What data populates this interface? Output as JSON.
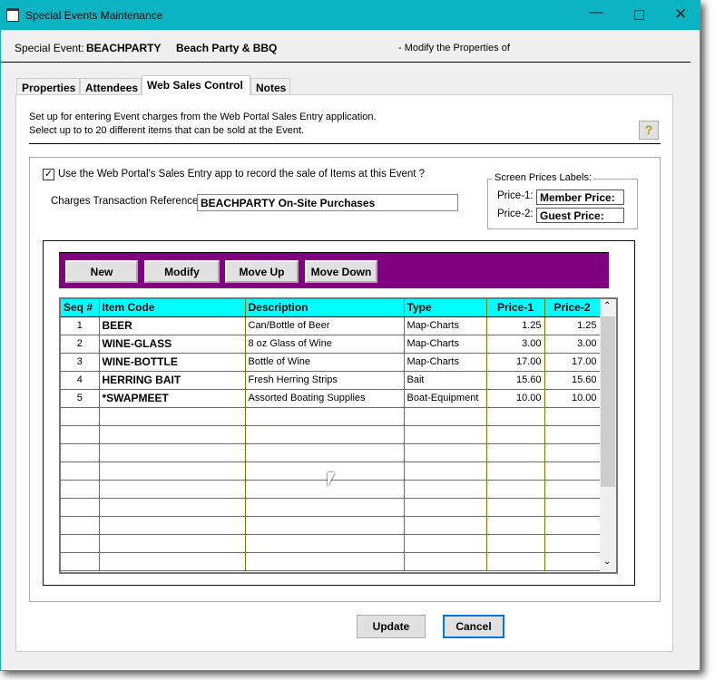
{
  "window": {
    "title": "Special Events Maintenance"
  },
  "header": {
    "label": "Special Event:",
    "code": "BEACHPARTY",
    "name": "Beach Party & BBQ",
    "mode": "- Modify the Properties of"
  },
  "tabs": [
    {
      "label": "Properties"
    },
    {
      "label": "Attendees"
    },
    {
      "label": "Web Sales Control",
      "active": true
    },
    {
      "label": "Notes"
    }
  ],
  "intro": [
    "Set up for entering Event charges from the Web Portal Sales Entry application.",
    "Select up to to 20 different items that can be sold at the Event."
  ],
  "use_web_portal": {
    "label": "Use the Web Portal's Sales Entry app to record the sale of Items at this Event ?",
    "checked": true
  },
  "charges_ref": {
    "label": "Charges Transaction Reference:",
    "value": "BEACHPARTY On-Site Purchases"
  },
  "price_labels": {
    "legend": "Screen Prices Labels:",
    "price1_label": "Price-1:",
    "price1_value": "Member Price:",
    "price2_label": "Price-2:",
    "price2_value": "Guest Price:"
  },
  "toolbar": {
    "new": "New",
    "modify": "Modify",
    "move_up": "Move Up",
    "move_down": "Move Down"
  },
  "grid": {
    "columns": [
      "Seq #",
      "Item Code",
      "Description",
      "Type",
      "Price-1",
      "Price-2"
    ],
    "rows": [
      [
        "1",
        "BEER",
        "Can/Bottle of Beer",
        "Map-Charts",
        "1.25",
        "1.25"
      ],
      [
        "2",
        "WINE-GLASS",
        "8 oz Glass of Wine",
        "Map-Charts",
        "3.00",
        "3.00"
      ],
      [
        "3",
        "WINE-BOTTLE",
        "Bottle of Wine",
        "Map-Charts",
        "17.00",
        "17.00"
      ],
      [
        "4",
        "HERRING BAIT",
        "Fresh Herring Strips",
        "Bait",
        "15.60",
        "15.60"
      ],
      [
        "5",
        "*SWAPMEET",
        "Assorted Boating Supplies",
        "Boat-Equipment",
        "10.00",
        "10.00"
      ]
    ]
  },
  "footer": {
    "update": "Update",
    "cancel": "Cancel"
  },
  "colors": {
    "titlebar": "#0ab4c3",
    "toolbar": "#800080",
    "grid_header": "#00ffff"
  }
}
